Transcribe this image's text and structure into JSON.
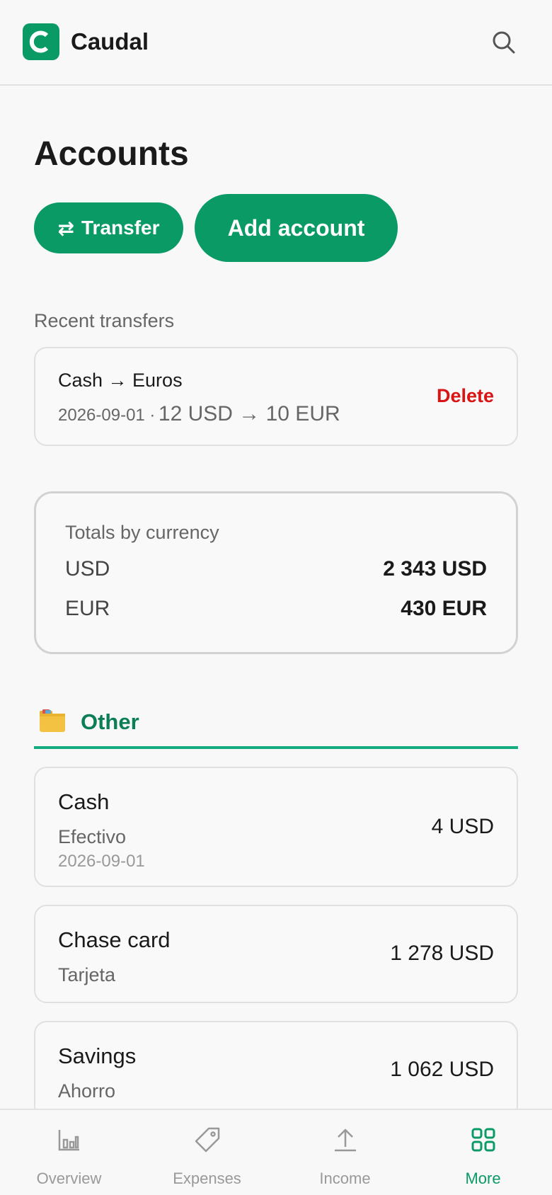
{
  "app": {
    "name": "Caudal",
    "logo_letter": "C",
    "accent_color": "#0a9a66",
    "danger_color": "#d91414"
  },
  "header": {
    "search_icon": "search-icon"
  },
  "page": {
    "title": "Accounts"
  },
  "actions": {
    "transfer_icon": "⇄",
    "transfer_label": "Transfer",
    "add_account_label": "Add account"
  },
  "recent_transfers": {
    "label": "Recent transfers",
    "items": [
      {
        "route": "Cash → Euros",
        "date": "2026-09-01 ·",
        "amount": "12 USD → 10 EUR",
        "delete_label": "Delete"
      }
    ]
  },
  "totals": {
    "title": "Totals by currency",
    "rows": [
      {
        "currency": "USD",
        "amount": "2 343 USD"
      },
      {
        "currency": "EUR",
        "amount": "430 EUR"
      }
    ]
  },
  "group": {
    "icon": "folder-icon",
    "title": "Other",
    "accounts": [
      {
        "name": "Cash",
        "type": "Efectivo",
        "date": "2026-09-01",
        "balance": "4 USD"
      },
      {
        "name": "Chase card",
        "type": "Tarjeta",
        "balance": "1 278 USD"
      },
      {
        "name": "Savings",
        "type": "Ahorro",
        "balance": "1 062 USD"
      }
    ]
  },
  "nav": {
    "items": [
      {
        "label": "Overview",
        "icon": "bar-chart-icon",
        "active": false
      },
      {
        "label": "Expenses",
        "icon": "tag-icon",
        "active": false
      },
      {
        "label": "Income",
        "icon": "upload-icon",
        "active": false
      },
      {
        "label": "More",
        "icon": "grid-icon",
        "active": true
      }
    ]
  }
}
